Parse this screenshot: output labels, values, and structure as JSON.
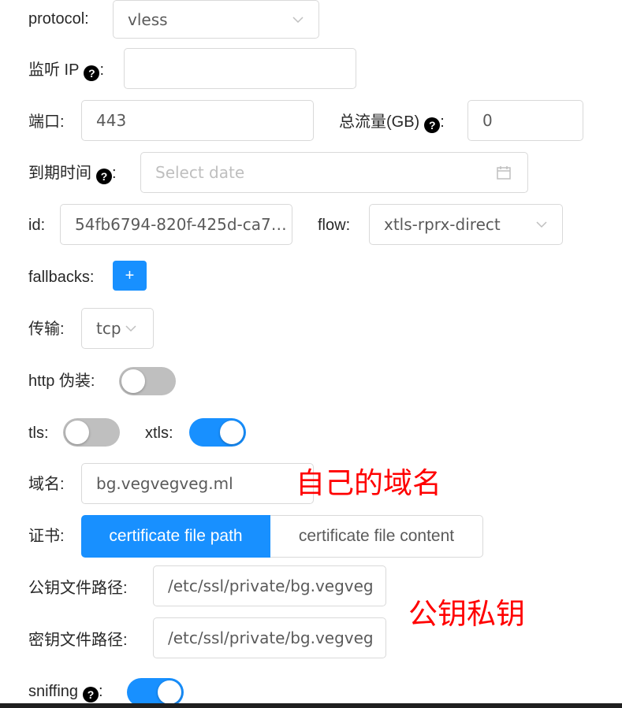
{
  "form": {
    "protocol": {
      "label": "protocol",
      "value": "vless"
    },
    "listen_ip": {
      "label": "监听 IP",
      "value": ""
    },
    "port": {
      "label": "端口",
      "value": "443"
    },
    "total_traffic": {
      "label": "总流量(GB)",
      "value": "0"
    },
    "expiry": {
      "label": "到期时间",
      "placeholder": "Select date"
    },
    "id": {
      "label": "id",
      "value": "54fb6794-820f-425d-ca7…"
    },
    "flow": {
      "label": "flow",
      "value": "xtls-rprx-direct"
    },
    "fallbacks": {
      "label": "fallbacks",
      "button": "+"
    },
    "transport": {
      "label": "传输",
      "value": "tcp"
    },
    "http_disguise": {
      "label": "http 伪装",
      "on": false
    },
    "tls": {
      "label": "tls",
      "on": false
    },
    "xtls": {
      "label": "xtls",
      "on": true
    },
    "domain": {
      "label": "域名",
      "value": "bg.vegvegveg.ml"
    },
    "certificate": {
      "label": "证书",
      "options": [
        "certificate file path",
        "certificate file content"
      ],
      "selected": 0
    },
    "public_key_path": {
      "label": "公钥文件路径",
      "value": "/etc/ssl/private/bg.vegveg"
    },
    "private_key_path": {
      "label": "密钥文件路径",
      "value": "/etc/ssl/private/bg.vegveg"
    },
    "sniffing": {
      "label": "sniffing",
      "on": true
    }
  },
  "annotations": {
    "domain_note": "自己的域名",
    "keys_note": "公钥私钥"
  },
  "colors": {
    "primary": "#1890ff",
    "annotation": "#ff0000",
    "switch_off": "#bfbfbf"
  }
}
